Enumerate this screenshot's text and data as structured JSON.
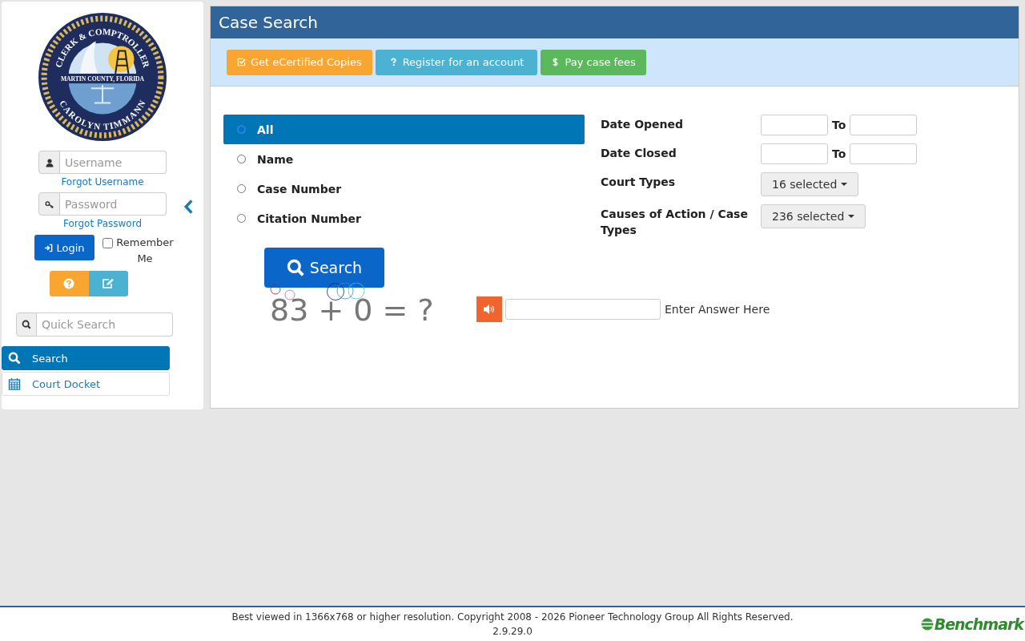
{
  "logo": {
    "top_text": "CLERK & COMPTROLLER",
    "middle_text": "MARTIN COUNTY, FLORIDA",
    "bottom_text": "CAROLYN TIMMANN"
  },
  "login": {
    "username_placeholder": "Username",
    "forgot_username": "Forgot Username",
    "password_placeholder": "Password",
    "forgot_password": "Forgot Password",
    "login_button": "Login",
    "remember_me": {
      "label": "Remember Me",
      "checked": false
    }
  },
  "quick_search": {
    "placeholder": "Quick Search"
  },
  "nav": [
    {
      "label": "Search",
      "kind": "search",
      "selected": true
    },
    {
      "label": "Court Docket",
      "kind": "calendar",
      "selected": false
    }
  ],
  "page_title": "Case Search",
  "actions": [
    {
      "label": "Get eCertified Copies",
      "kind": "certified"
    },
    {
      "label": "Register for an account",
      "kind": "register"
    },
    {
      "label": "Pay case fees",
      "kind": "pay"
    }
  ],
  "search_types": [
    {
      "label": "All",
      "selected": true
    },
    {
      "label": "Name",
      "selected": false
    },
    {
      "label": "Case Number",
      "selected": false
    },
    {
      "label": "Citation Number",
      "selected": false
    }
  ],
  "filters": [
    {
      "label": "Date Opened",
      "kind": "date_range",
      "to_label": "To"
    },
    {
      "label": "Date Closed",
      "kind": "date_range",
      "to_label": "To"
    },
    {
      "label": "Court Types",
      "kind": "multiselect",
      "value": "16 selected"
    },
    {
      "label": "Causes of Action / Case Types",
      "kind": "multiselect",
      "value": "236 selected"
    }
  ],
  "search_button": "Search",
  "captcha": {
    "question": "83 + 0 = ?",
    "answer_hint": "Enter Answer Here"
  },
  "footer": {
    "notice": "Best viewed in 1366x768 or higher resolution. Copyright 2008 - 2026 Pioneer Technology Group All Rights Reserved.",
    "version": "2.9.29.0",
    "brand": "Benchmark"
  }
}
